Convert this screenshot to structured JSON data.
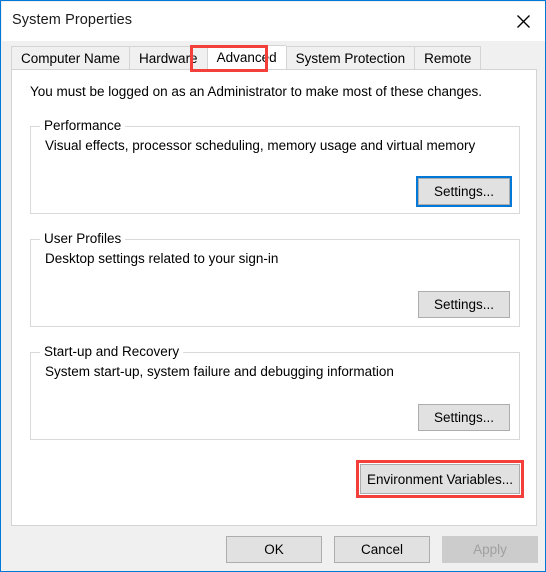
{
  "window": {
    "title": "System Properties",
    "close_icon": "close-icon",
    "accent_color": "#0078d7",
    "highlight_color": "#f4403a"
  },
  "tabs": [
    {
      "label": "Computer Name",
      "active": false
    },
    {
      "label": "Hardware",
      "active": false
    },
    {
      "label": "Advanced",
      "active": true,
      "highlighted": true
    },
    {
      "label": "System Protection",
      "active": false
    },
    {
      "label": "Remote",
      "active": false
    }
  ],
  "panel": {
    "admin_note": "You must be logged on as an Administrator to make most of these changes.",
    "groups": [
      {
        "legend": "Performance",
        "description": "Visual effects, processor scheduling, memory usage and virtual memory",
        "button_label": "Settings...",
        "button_focused": true
      },
      {
        "legend": "User Profiles",
        "description": "Desktop settings related to your sign-in",
        "button_label": "Settings...",
        "button_focused": false
      },
      {
        "legend": "Start-up and Recovery",
        "description": "System start-up, system failure and debugging information",
        "button_label": "Settings...",
        "button_focused": false
      }
    ],
    "env_button_label": "Environment Variables...",
    "env_button_highlighted": true
  },
  "footer": {
    "ok_label": "OK",
    "cancel_label": "Cancel",
    "apply_label": "Apply",
    "apply_disabled": true
  }
}
